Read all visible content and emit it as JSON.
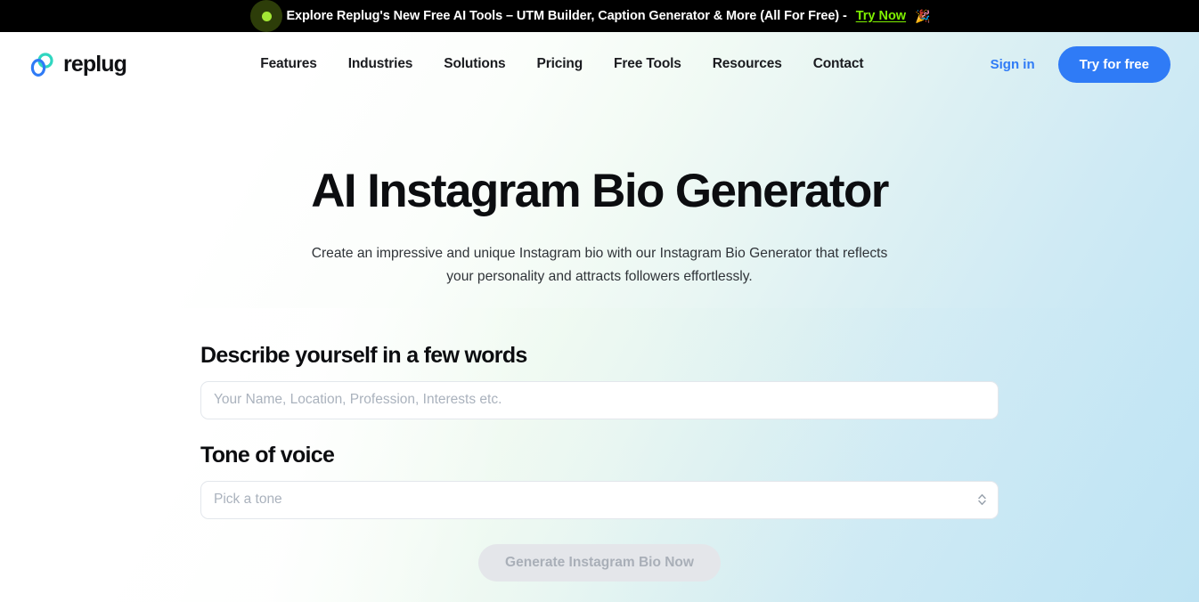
{
  "banner": {
    "dot_icon": "status-dot-icon",
    "text": "Explore Replug's New Free AI Tools – UTM Builder, Caption Generator & More (All For Free) -",
    "link_label": "Try Now",
    "emoji": "🎉",
    "background_color": "#000000",
    "link_color": "#7ef000",
    "dot_color": "#a3e635"
  },
  "header": {
    "logo": {
      "icon": "replug-rings-logo-icon",
      "text": "replug",
      "teal_color": "#2fd6c0",
      "blue_color": "#2f7bf6"
    },
    "nav_items": [
      {
        "label": "Features"
      },
      {
        "label": "Industries"
      },
      {
        "label": "Solutions"
      },
      {
        "label": "Pricing"
      },
      {
        "label": "Free Tools"
      },
      {
        "label": "Resources"
      },
      {
        "label": "Contact"
      }
    ],
    "sign_in_label": "Sign in",
    "try_free_label": "Try for free",
    "accent_color": "#2f7bf6"
  },
  "hero": {
    "title": "AI Instagram Bio Generator",
    "subtitle": "Create an impressive and unique Instagram bio with our Instagram Bio Generator that reflects your personality and attracts followers effortlessly."
  },
  "form": {
    "describe": {
      "label": "Describe yourself in a few words",
      "value": "",
      "placeholder": "Your Name, Location, Profession, Interests etc."
    },
    "tone": {
      "label": "Tone of voice",
      "value": "",
      "placeholder": "Pick a tone",
      "chevron_icon": "chevron-up-down-icon"
    },
    "generate_label": "Generate Instagram Bio Now"
  }
}
